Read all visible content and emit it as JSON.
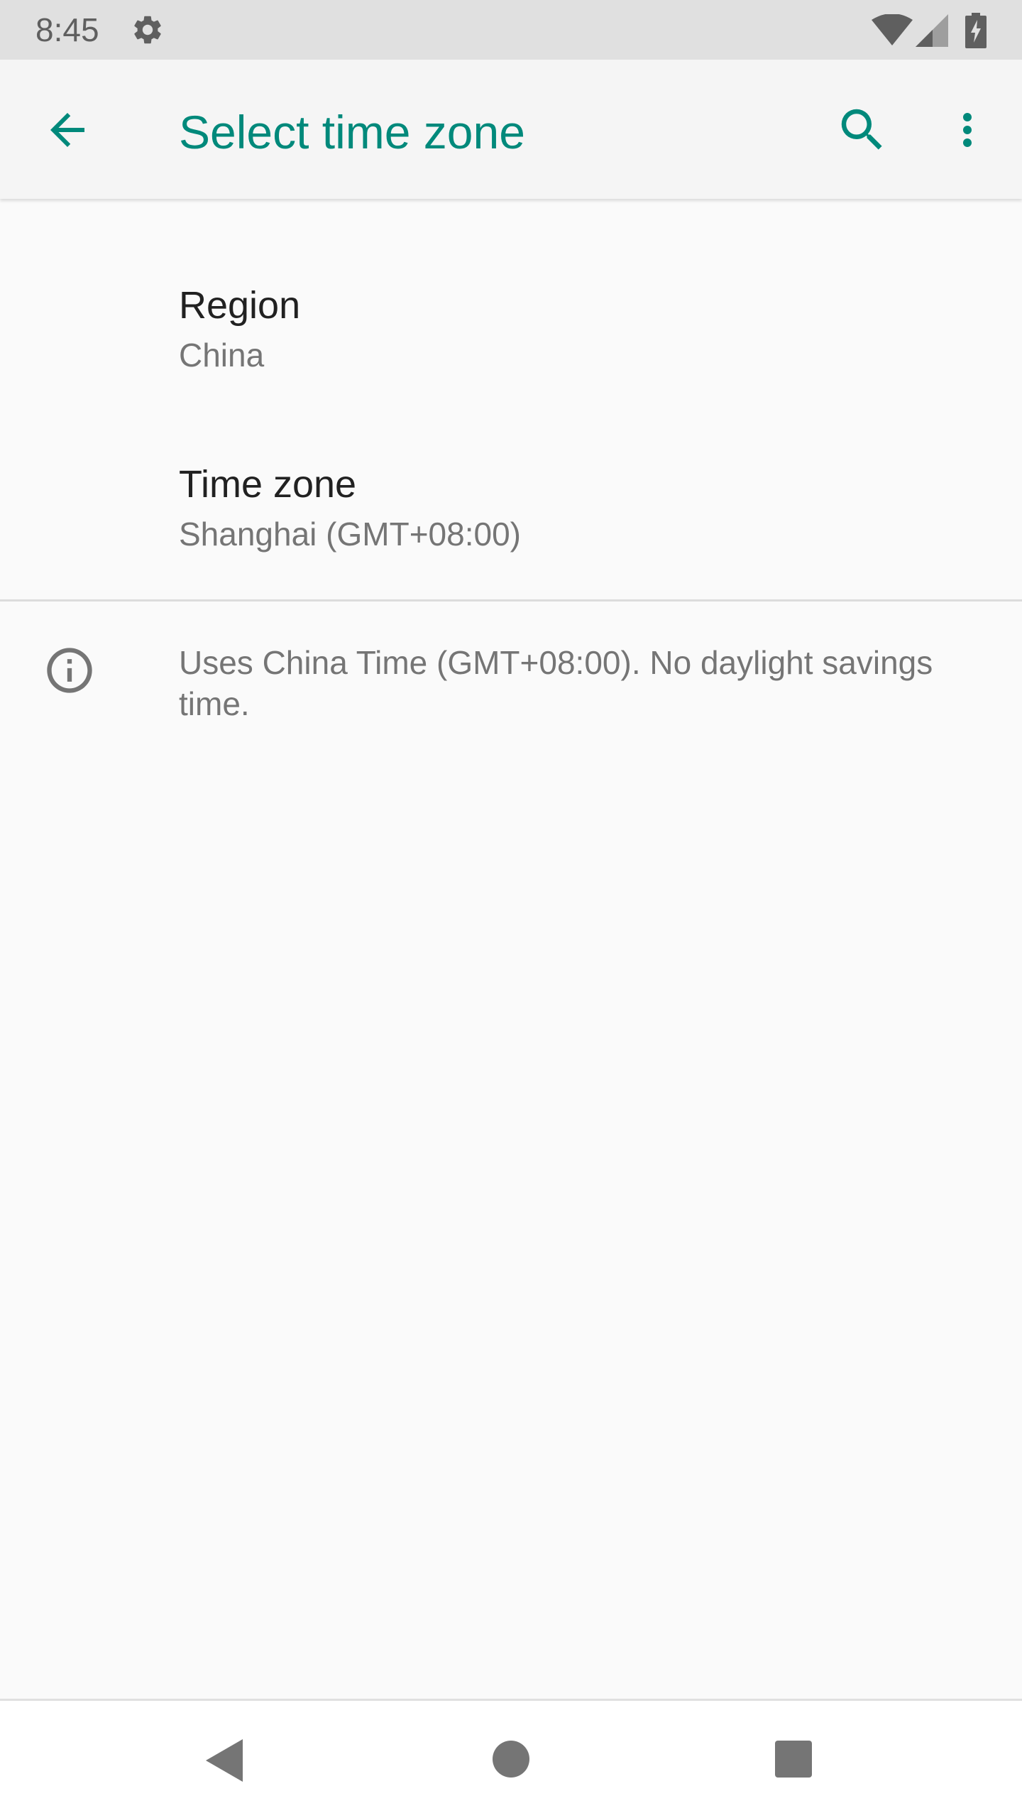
{
  "status_bar": {
    "time": "8:45",
    "icons": [
      "gear-icon",
      "wifi-icon",
      "cell-signal-icon",
      "battery-charging-icon"
    ]
  },
  "app_bar": {
    "title": "Select time zone",
    "back_icon": "arrow-back-icon",
    "search_icon": "search-icon",
    "more_icon": "more-vert-icon",
    "accent_color": "#00897b"
  },
  "preferences": [
    {
      "title": "Region",
      "summary": "China"
    },
    {
      "title": "Time zone",
      "summary": "Shanghai (GMT+08:00)"
    }
  ],
  "footer_info": {
    "icon": "info-icon",
    "text": "Uses China Time (GMT+08:00). No daylight savings time."
  },
  "nav_bar": {
    "icons": [
      "nav-back-icon",
      "nav-home-icon",
      "nav-recents-icon"
    ]
  }
}
